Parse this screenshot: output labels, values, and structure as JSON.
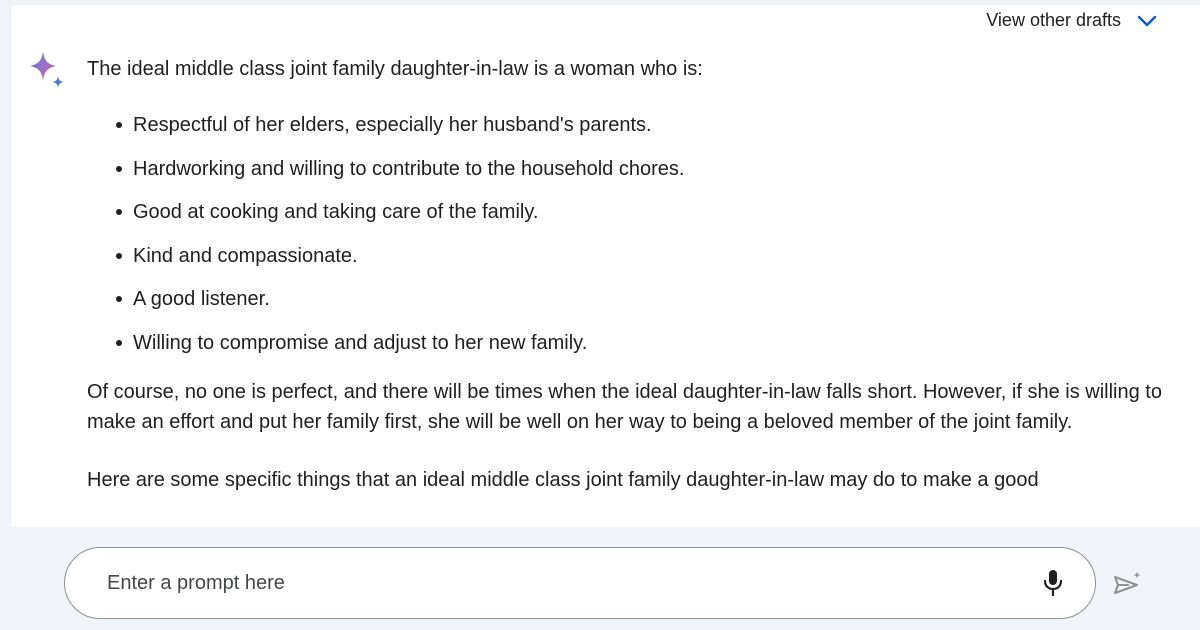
{
  "header": {
    "drafts_label": "View other drafts",
    "drafts_icon": "chevron-down-icon"
  },
  "assistant": {
    "logo_icon": "sparkle-logo-icon"
  },
  "response": {
    "intro": "The ideal middle class joint family daughter-in-law is a woman who is:",
    "bullets": [
      "Respectful of her elders, especially her husband's parents.",
      "Hardworking and willing to contribute to the household chores.",
      "Good at cooking and taking care of the family.",
      "Kind and compassionate.",
      "A good listener.",
      "Willing to compromise and adjust to her new family."
    ],
    "paragraph": "Of course, no one is perfect, and there will be times when the ideal daughter-in-law falls short. However, if she is willing to make an effort and put her family first, she will be well on her way to being a beloved member of the joint family.",
    "cut_off_line": "Here are some specific things that an ideal middle class joint family daughter-in-law may do to make a good"
  },
  "prompt": {
    "placeholder": "Enter a prompt here",
    "mic_icon": "microphone-icon",
    "send_icon": "send-icon"
  },
  "colors": {
    "background": "#f0f4f9",
    "card": "#ffffff",
    "text": "#1f1f1f",
    "accent_blue": "#0b57d0"
  }
}
